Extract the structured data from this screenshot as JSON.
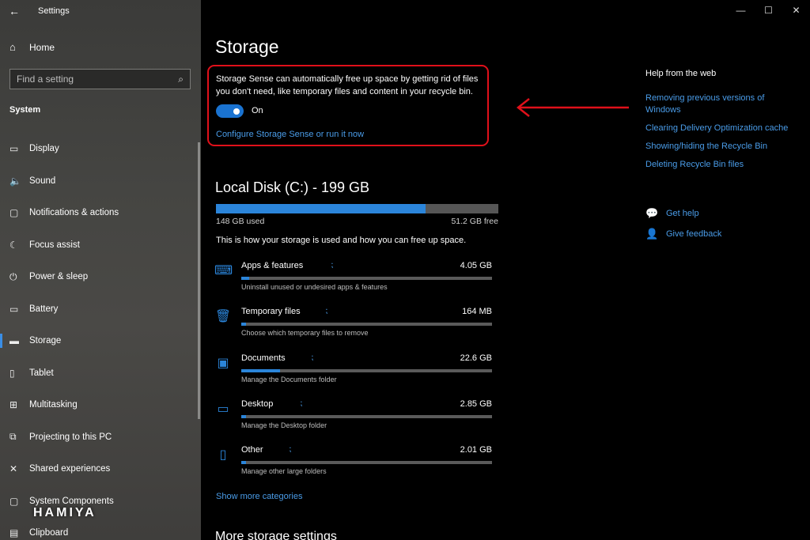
{
  "app": {
    "title": "Settings"
  },
  "window_controls": {
    "minimize": "—",
    "maximize": "☐",
    "close": "✕"
  },
  "sidebar": {
    "home": "Home",
    "search_placeholder": "Find a setting",
    "section": "System",
    "items": [
      {
        "label": "Display",
        "icon": "display-icon",
        "glyph": "▭"
      },
      {
        "label": "Sound",
        "icon": "sound-icon",
        "glyph": "🔈"
      },
      {
        "label": "Notifications & actions",
        "icon": "notifications-icon",
        "glyph": "▢"
      },
      {
        "label": "Focus assist",
        "icon": "moon-icon",
        "glyph": "☾"
      },
      {
        "label": "Power & sleep",
        "icon": "power-icon",
        "glyph": "⏻"
      },
      {
        "label": "Battery",
        "icon": "battery-icon",
        "glyph": "▭"
      },
      {
        "label": "Storage",
        "icon": "storage-icon",
        "glyph": "▬",
        "active": true
      },
      {
        "label": "Tablet",
        "icon": "tablet-icon",
        "glyph": "▯"
      },
      {
        "label": "Multitasking",
        "icon": "multitasking-icon",
        "glyph": "⊞"
      },
      {
        "label": "Projecting to this PC",
        "icon": "projecting-icon",
        "glyph": "⧉"
      },
      {
        "label": "Shared experiences",
        "icon": "shared-icon",
        "glyph": "✕"
      },
      {
        "label": "System Components",
        "icon": "components-icon",
        "glyph": "▢"
      },
      {
        "label": "Clipboard",
        "icon": "clipboard-icon",
        "glyph": "▤"
      }
    ]
  },
  "watermark": "HAMIYA",
  "main": {
    "title": "Storage",
    "storage_sense": {
      "description": "Storage Sense can automatically free up space by getting rid of files you don't need, like temporary files and content in your recycle bin.",
      "toggle_state": "On",
      "toggle_on": true,
      "configure_link": "Configure Storage Sense or run it now"
    },
    "disk": {
      "title": "Local Disk (C:) - 199 GB",
      "used_label": "148 GB used",
      "free_label": "51.2 GB free",
      "used_fraction": 0.743,
      "description": "This is how your storage is used and how you can free up space."
    },
    "categories": [
      {
        "name": "Apps & features",
        "size": "4.05 GB",
        "sub": "Uninstall unused or undesired apps & features",
        "fill": 0.03,
        "icon": "apps-icon",
        "glyph": "⌨"
      },
      {
        "name": "Temporary files",
        "size": "164 MB",
        "sub": "Choose which temporary files to remove",
        "fill": 0.005,
        "icon": "trash-icon",
        "glyph": "🗑"
      },
      {
        "name": "Documents",
        "size": "22.6 GB",
        "sub": "Manage the Documents folder",
        "fill": 0.155,
        "icon": "documents-icon",
        "glyph": "▣"
      },
      {
        "name": "Desktop",
        "size": "2.85 GB",
        "sub": "Manage the Desktop folder",
        "fill": 0.02,
        "icon": "desktop-icon",
        "glyph": "▭"
      },
      {
        "name": "Other",
        "size": "2.01 GB",
        "sub": "Manage other large folders",
        "fill": 0.015,
        "icon": "other-icon",
        "glyph": "▯"
      }
    ],
    "show_more": "Show more categories",
    "more_settings": "More storage settings"
  },
  "help": {
    "title": "Help from the web",
    "links": [
      "Removing previous versions of Windows",
      "Clearing Delivery Optimization cache",
      "Showing/hiding the Recycle Bin",
      "Deleting Recycle Bin files"
    ],
    "get_help": "Get help",
    "give_feedback": "Give feedback"
  },
  "colors": {
    "accent": "#2b85da",
    "link": "#4a9ce8",
    "highlight_box": "#e0101a"
  }
}
